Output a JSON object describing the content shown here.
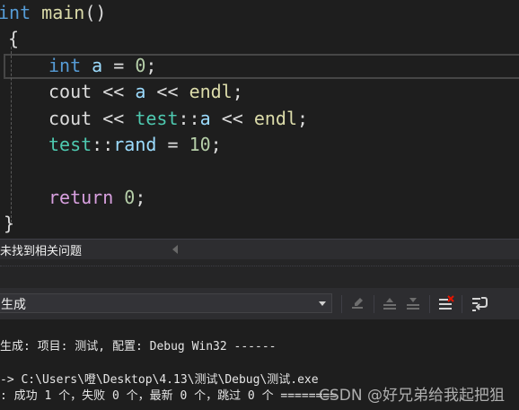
{
  "editor": {
    "lines": [
      {
        "tokens": [
          {
            "text": "int",
            "kind": "kw"
          },
          {
            "text": " ",
            "kind": "txt"
          },
          {
            "text": "main",
            "kind": "fn"
          },
          {
            "text": "()",
            "kind": "txt"
          }
        ]
      },
      {
        "tokens": [
          {
            "text": "{",
            "kind": "txt"
          }
        ]
      },
      {
        "tokens": [
          {
            "text": "int",
            "kind": "kw"
          },
          {
            "text": " ",
            "kind": "txt"
          },
          {
            "text": "a",
            "kind": "var"
          },
          {
            "text": " = ",
            "kind": "txt"
          },
          {
            "text": "0",
            "kind": "num"
          },
          {
            "text": ";",
            "kind": "txt"
          }
        ]
      },
      {
        "tokens": [
          {
            "text": "cout",
            "kind": "txt"
          },
          {
            "text": " << ",
            "kind": "txt"
          },
          {
            "text": "a",
            "kind": "var"
          },
          {
            "text": " << ",
            "kind": "txt"
          },
          {
            "text": "endl",
            "kind": "fn"
          },
          {
            "text": ";",
            "kind": "txt"
          }
        ]
      },
      {
        "tokens": [
          {
            "text": "cout",
            "kind": "txt"
          },
          {
            "text": " << ",
            "kind": "txt"
          },
          {
            "text": "test",
            "kind": "ns"
          },
          {
            "text": "::",
            "kind": "txt"
          },
          {
            "text": "a",
            "kind": "var"
          },
          {
            "text": " << ",
            "kind": "txt"
          },
          {
            "text": "endl",
            "kind": "fn"
          },
          {
            "text": ";",
            "kind": "txt"
          }
        ]
      },
      {
        "tokens": [
          {
            "text": "test",
            "kind": "ns"
          },
          {
            "text": "::",
            "kind": "txt"
          },
          {
            "text": "rand",
            "kind": "var"
          },
          {
            "text": " = ",
            "kind": "txt"
          },
          {
            "text": "10",
            "kind": "num"
          },
          {
            "text": ";",
            "kind": "txt"
          }
        ]
      },
      {
        "tokens": []
      },
      {
        "tokens": [
          {
            "text": "return",
            "kind": "kw2"
          },
          {
            "text": " ",
            "kind": "txt"
          },
          {
            "text": "0",
            "kind": "num"
          },
          {
            "text": ";",
            "kind": "txt"
          }
        ]
      },
      {
        "tokens": [
          {
            "text": "}",
            "kind": "txt"
          }
        ]
      }
    ]
  },
  "issues": {
    "text": "未找到相关问题"
  },
  "output": {
    "source_label": "生成",
    "toolbar_icons": [
      "goto-location-icon",
      "previous-message-icon",
      "next-message-icon",
      "clear-all-icon",
      "toggle-word-wrap-icon"
    ],
    "lines": [
      "生成: 项目: 测试, 配置: Debug Win32 ------",
      "-> C:\\Users\\噔\\Desktop\\4.13\\测试\\Debug\\测试.exe",
      ": 成功 1 个，失败 0 个，最新 0 个，跳过 0 个 ========"
    ]
  },
  "watermark": "CSDN @好兄弟给我起把狙",
  "colors": {
    "background": "#1e1e1e",
    "keyword": "#569cd6",
    "control_keyword": "#d8a0df",
    "function": "#dcdcaa",
    "variable": "#9cdcfe",
    "number": "#b5cea8",
    "namespace": "#4ec9b0",
    "text": "#dcdcdc"
  }
}
